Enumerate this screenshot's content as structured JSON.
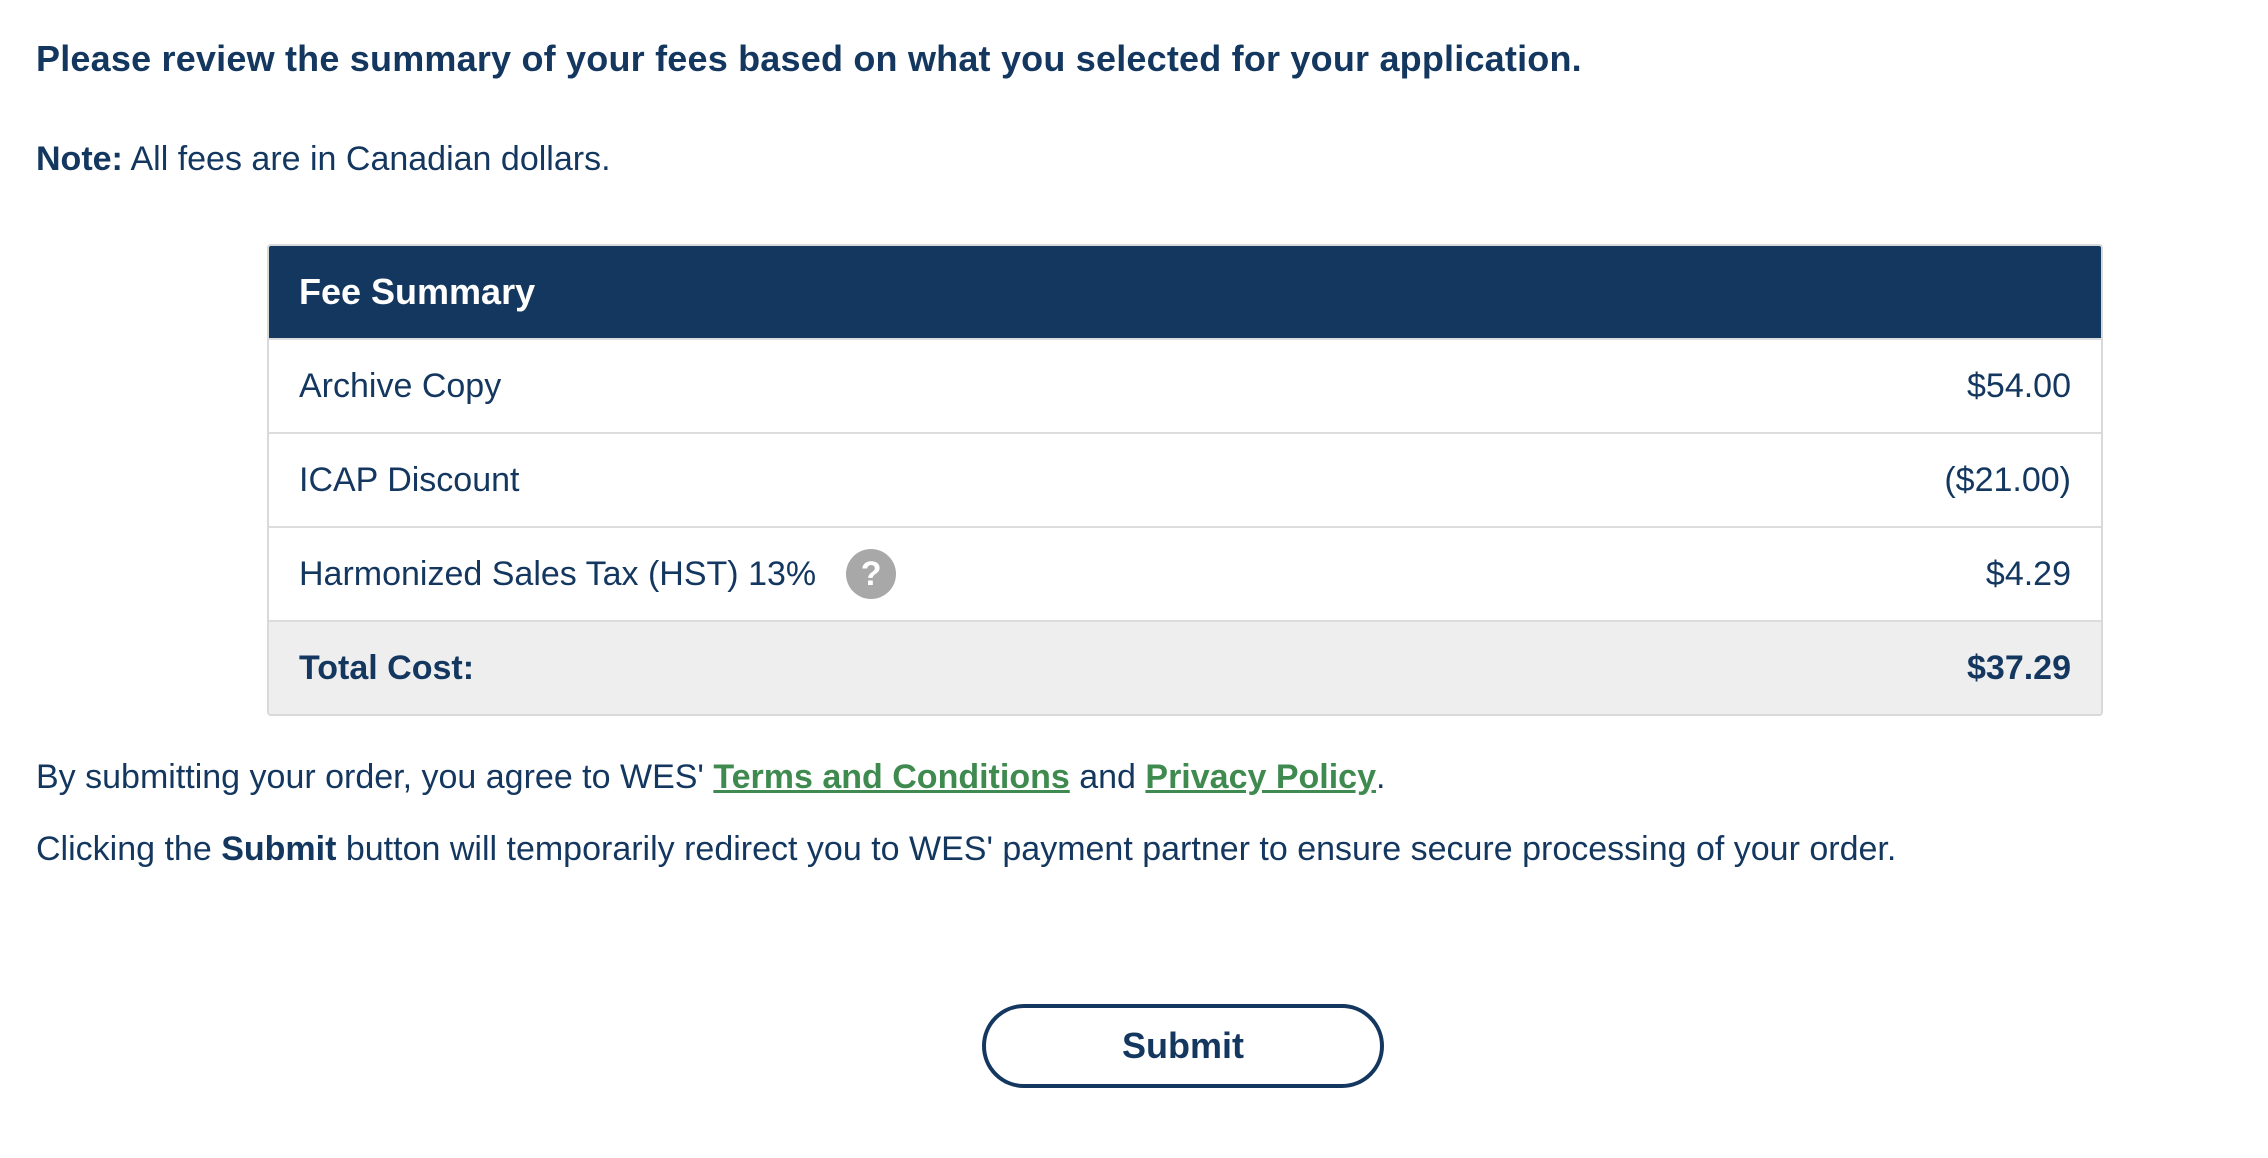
{
  "intro": {
    "heading": "Please review the summary of your fees based on what you selected for your application.",
    "note_label": "Note:",
    "note_text": " All fees are in Canadian dollars."
  },
  "fee_summary": {
    "title": "Fee Summary",
    "rows": [
      {
        "label": "Archive Copy",
        "amount": "$54.00"
      },
      {
        "label": "ICAP Discount",
        "amount": "($21.00)"
      },
      {
        "label": "Harmonized Sales Tax (HST) 13%",
        "amount": "$4.29",
        "help_icon": "question-mark-icon",
        "help_glyph": "?"
      }
    ],
    "total_label": "Total Cost:",
    "total_amount": "$37.29"
  },
  "agreement": {
    "prefix": "By submitting your order, you agree to WES' ",
    "terms_link": "Terms and Conditions",
    "middle": " and ",
    "privacy_link": "Privacy Policy",
    "suffix": "."
  },
  "redirect_notice": {
    "prefix": "Clicking the ",
    "bold": "Submit",
    "suffix": " button will temporarily redirect you to WES' payment partner to ensure secure processing of your order."
  },
  "submit_button": {
    "label": "Submit"
  },
  "colors": {
    "primary_navy": "#14375f",
    "link_green": "#3f8a4f",
    "total_row_bg": "#eeeeee",
    "help_icon_gray": "#a8a8a8"
  }
}
